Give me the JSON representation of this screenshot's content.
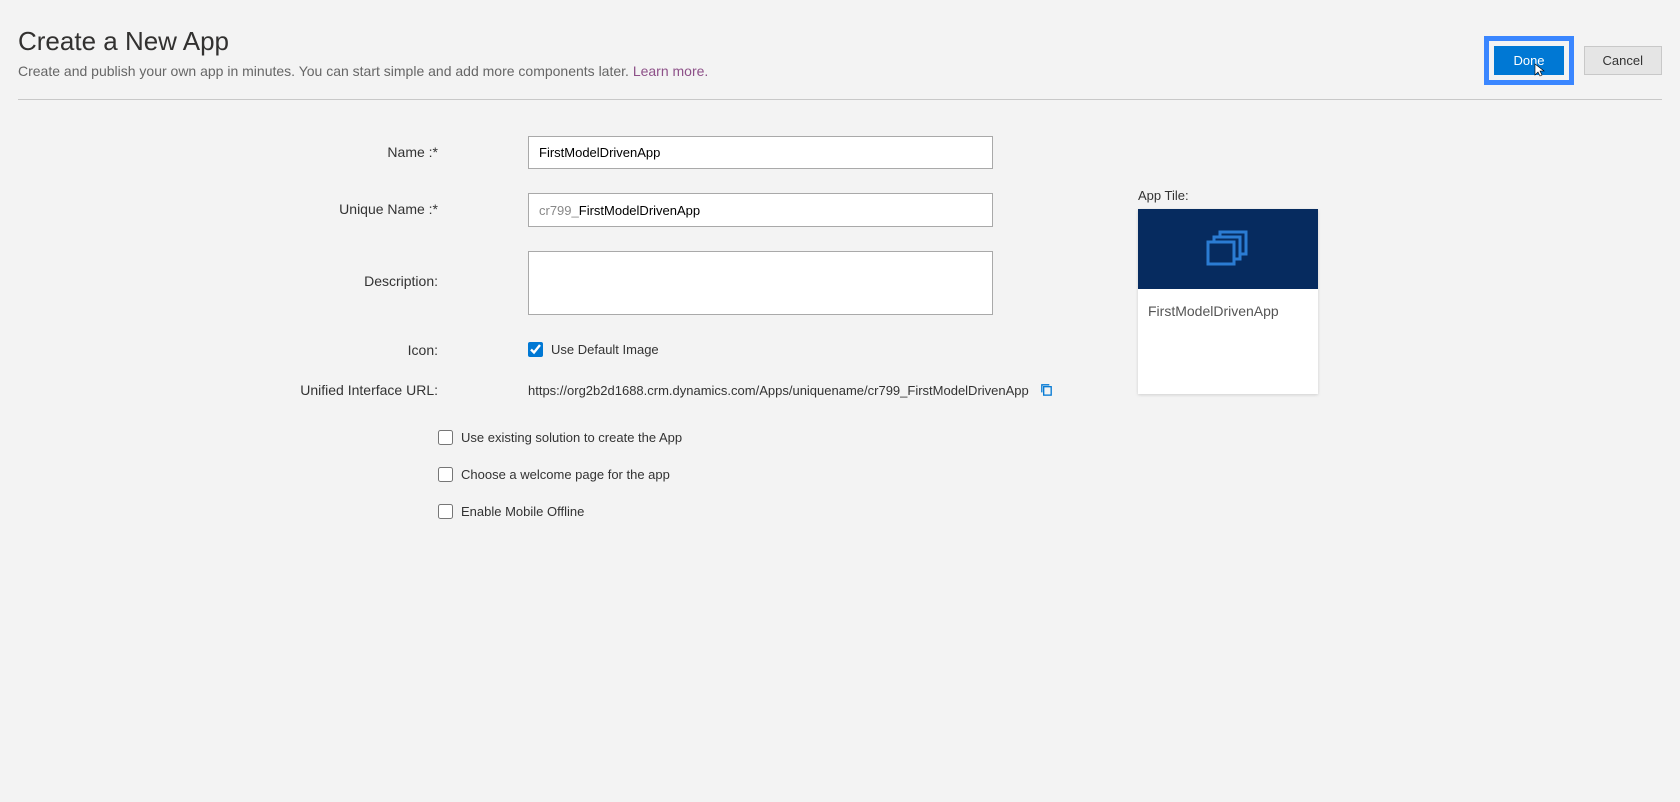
{
  "header": {
    "title": "Create a New App",
    "subtitle_prefix": "Create and publish your own app in minutes. You can start simple and add more components later. ",
    "learn_more": "Learn more.",
    "done_label": "Done",
    "cancel_label": "Cancel"
  },
  "form": {
    "name": {
      "label": "Name :*",
      "value": "FirstModelDrivenApp"
    },
    "unique_name": {
      "label": "Unique Name :*",
      "prefix": "cr799_",
      "value": "FirstModelDrivenApp"
    },
    "description": {
      "label": "Description:",
      "value": ""
    },
    "icon": {
      "label": "Icon:",
      "checkbox_label": "Use Default Image",
      "checked": true
    },
    "url": {
      "label": "Unified Interface URL:",
      "value": "https://org2b2d1688.crm.dynamics.com/Apps/uniquename/cr799_FirstModelDrivenApp"
    },
    "options": {
      "use_existing_solution": "Use existing solution to create the App",
      "choose_welcome_page": "Choose a welcome page for the app",
      "enable_mobile_offline": "Enable Mobile Offline"
    }
  },
  "tile": {
    "label": "App Tile:",
    "app_name": "FirstModelDrivenApp"
  }
}
